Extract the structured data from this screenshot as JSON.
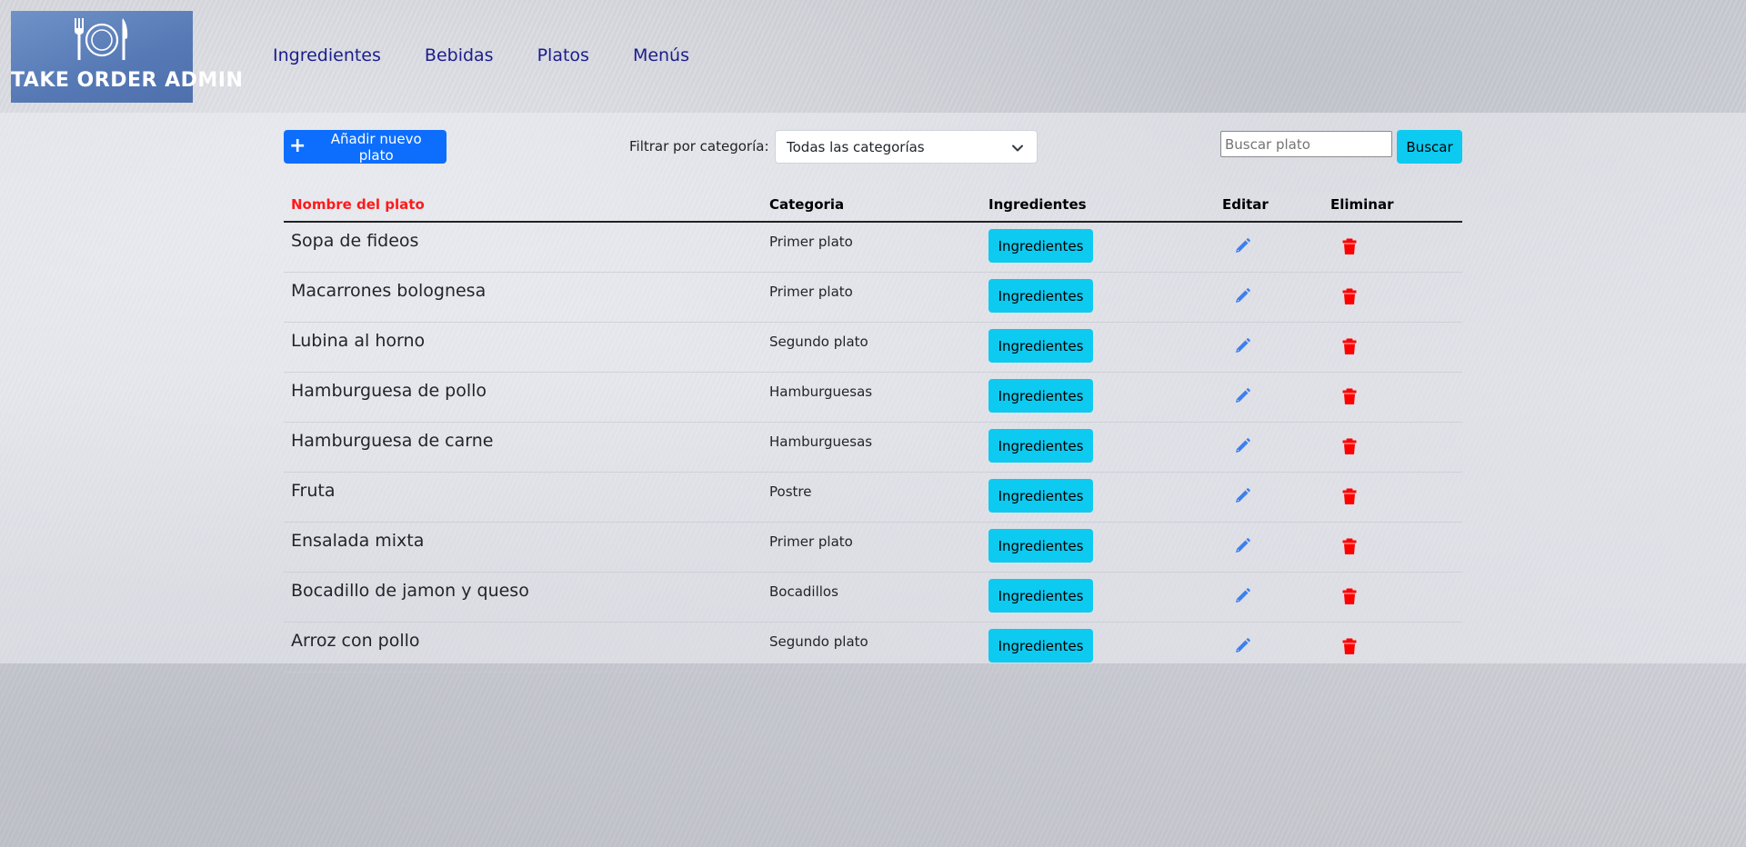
{
  "header": {
    "logo_text": "TAKE ORDER ADMIN",
    "logo_icon": "plate-fork-knife-icon",
    "nav": [
      {
        "label": "Ingredientes"
      },
      {
        "label": "Bebidas"
      },
      {
        "label": "Platos"
      },
      {
        "label": "Menús"
      }
    ]
  },
  "toolbar": {
    "add_label": "Añadir nuevo plato",
    "filter_label": "Filtrar por categoría:",
    "filter_selected": "Todas las categorías",
    "search_placeholder": "Buscar plato",
    "search_value": "",
    "search_button": "Buscar"
  },
  "table": {
    "headers": {
      "name": "Nombre del plato",
      "category": "Categoria",
      "ingredients": "Ingredientes",
      "edit": "Editar",
      "delete": "Eliminar"
    },
    "ingredients_button": "Ingredientes",
    "rows": [
      {
        "name": "Sopa de fideos",
        "category": "Primer plato"
      },
      {
        "name": "Macarrones bolognesa",
        "category": "Primer plato"
      },
      {
        "name": "Lubina al horno",
        "category": "Segundo plato"
      },
      {
        "name": "Hamburguesa de pollo",
        "category": "Hamburguesas"
      },
      {
        "name": "Hamburguesa de carne",
        "category": "Hamburguesas"
      },
      {
        "name": "Fruta",
        "category": "Postre"
      },
      {
        "name": "Ensalada mixta",
        "category": "Primer plato"
      },
      {
        "name": "Bocadillo de jamon y queso",
        "category": "Bocadillos"
      },
      {
        "name": "Arroz con pollo",
        "category": "Segundo plato"
      }
    ]
  },
  "colors": {
    "primary": "#0d6efd",
    "info": "#0dcaf0",
    "danger": "#ff0000",
    "nav_link": "#1b1d8c",
    "logo_bg": "#5a7dba",
    "sorted_header": "#ff1a1a"
  },
  "icons": {
    "edit": "pencil-icon",
    "delete": "trash-icon",
    "add": "plus-icon",
    "select": "chevron-down-icon"
  }
}
